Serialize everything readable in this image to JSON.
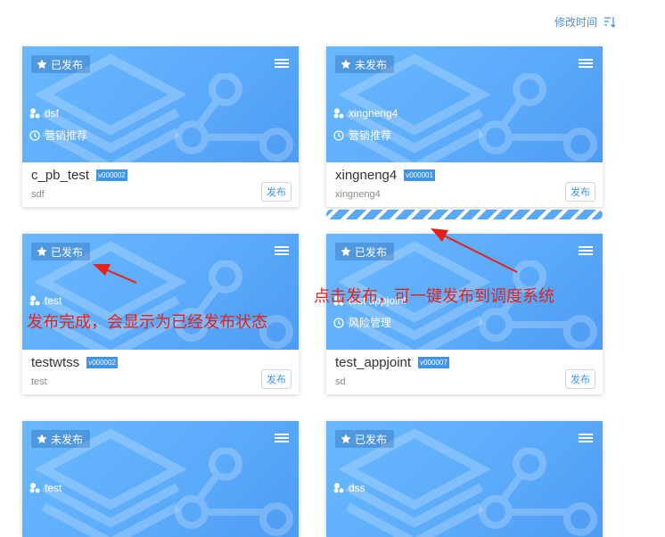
{
  "sort": {
    "label": "修改时间",
    "icon": "sort-descending-icon"
  },
  "cards": [
    {
      "status": "已发布",
      "tag": "dsf",
      "category": "营销推荐",
      "title": "c_pb_test",
      "version": "v000002",
      "desc": "sdf",
      "button": "发布"
    },
    {
      "status": "未发布",
      "tag": "xingneng4",
      "category": "营销推荐",
      "title": "xingneng4",
      "version": "v000001",
      "desc": "xingneng4",
      "button": "发布"
    },
    {
      "status": "已发布",
      "tag": "test",
      "category": "",
      "title": "testwtss",
      "version": "v000002",
      "desc": "test",
      "button": "发布"
    },
    {
      "status": "已发布",
      "tag": "test appjoint",
      "category": "风险管理",
      "title": "test_appjoint",
      "version": "v000007",
      "desc": "sd",
      "button": "发布"
    },
    {
      "status": "未发布",
      "tag": "test",
      "category": "",
      "title": "",
      "version": "",
      "desc": "",
      "button": ""
    },
    {
      "status": "已发布",
      "tag": "dss",
      "category": "",
      "title": "",
      "version": "",
      "desc": "",
      "button": ""
    }
  ],
  "progress": {
    "state": "publishing"
  },
  "annotations": {
    "publish_hint": "点击发布，可一键发布到调度系统",
    "done_hint": "发布完成，会显示为已经发布状态"
  },
  "colors": {
    "banner": "#5cabfb",
    "accent": "#3d95ee",
    "annotation": "#e8201a"
  }
}
